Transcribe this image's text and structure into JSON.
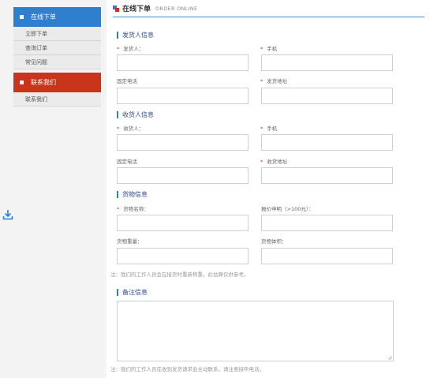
{
  "sidebar": {
    "group1": {
      "title": "在线下单",
      "items": [
        "立即下单",
        "查询订单",
        "常见问题"
      ]
    },
    "group2": {
      "title": "联系我们",
      "items": [
        "联系我们"
      ]
    }
  },
  "header": {
    "title_cn": "在线下单",
    "title_en": "ORDER ONLINE"
  },
  "sender": {
    "section_title": "发货人信息",
    "name_label": "发货人：",
    "mobile_label": "手机",
    "phone_label": "固定电话",
    "address_label": "发货地址"
  },
  "receiver": {
    "section_title": "收货人信息",
    "name_label": "收货人：",
    "mobile_label": "手机",
    "phone_label": "固定电话",
    "address_label": "收货地址"
  },
  "cargo": {
    "section_title": "货物信息",
    "name_label": "货物名称：",
    "value_label": "报价申明（>100元）：",
    "weight_label": "货物重量：",
    "volume_label": "货物体积："
  },
  "cargo_note": "注：我们的工作人员会在接货时重新称重，此估算仅供参考。",
  "remarks": {
    "section_title": "备注信息"
  },
  "footer_note": "注：我们的工作人员在收到发货请求会主动联系，请注意接听电话。",
  "required_mark": "*",
  "colors": {
    "accent_blue": "#2f7fd0",
    "accent_red": "#c8351c",
    "required": "#d0321c"
  },
  "icons": {
    "download": "download-icon"
  }
}
